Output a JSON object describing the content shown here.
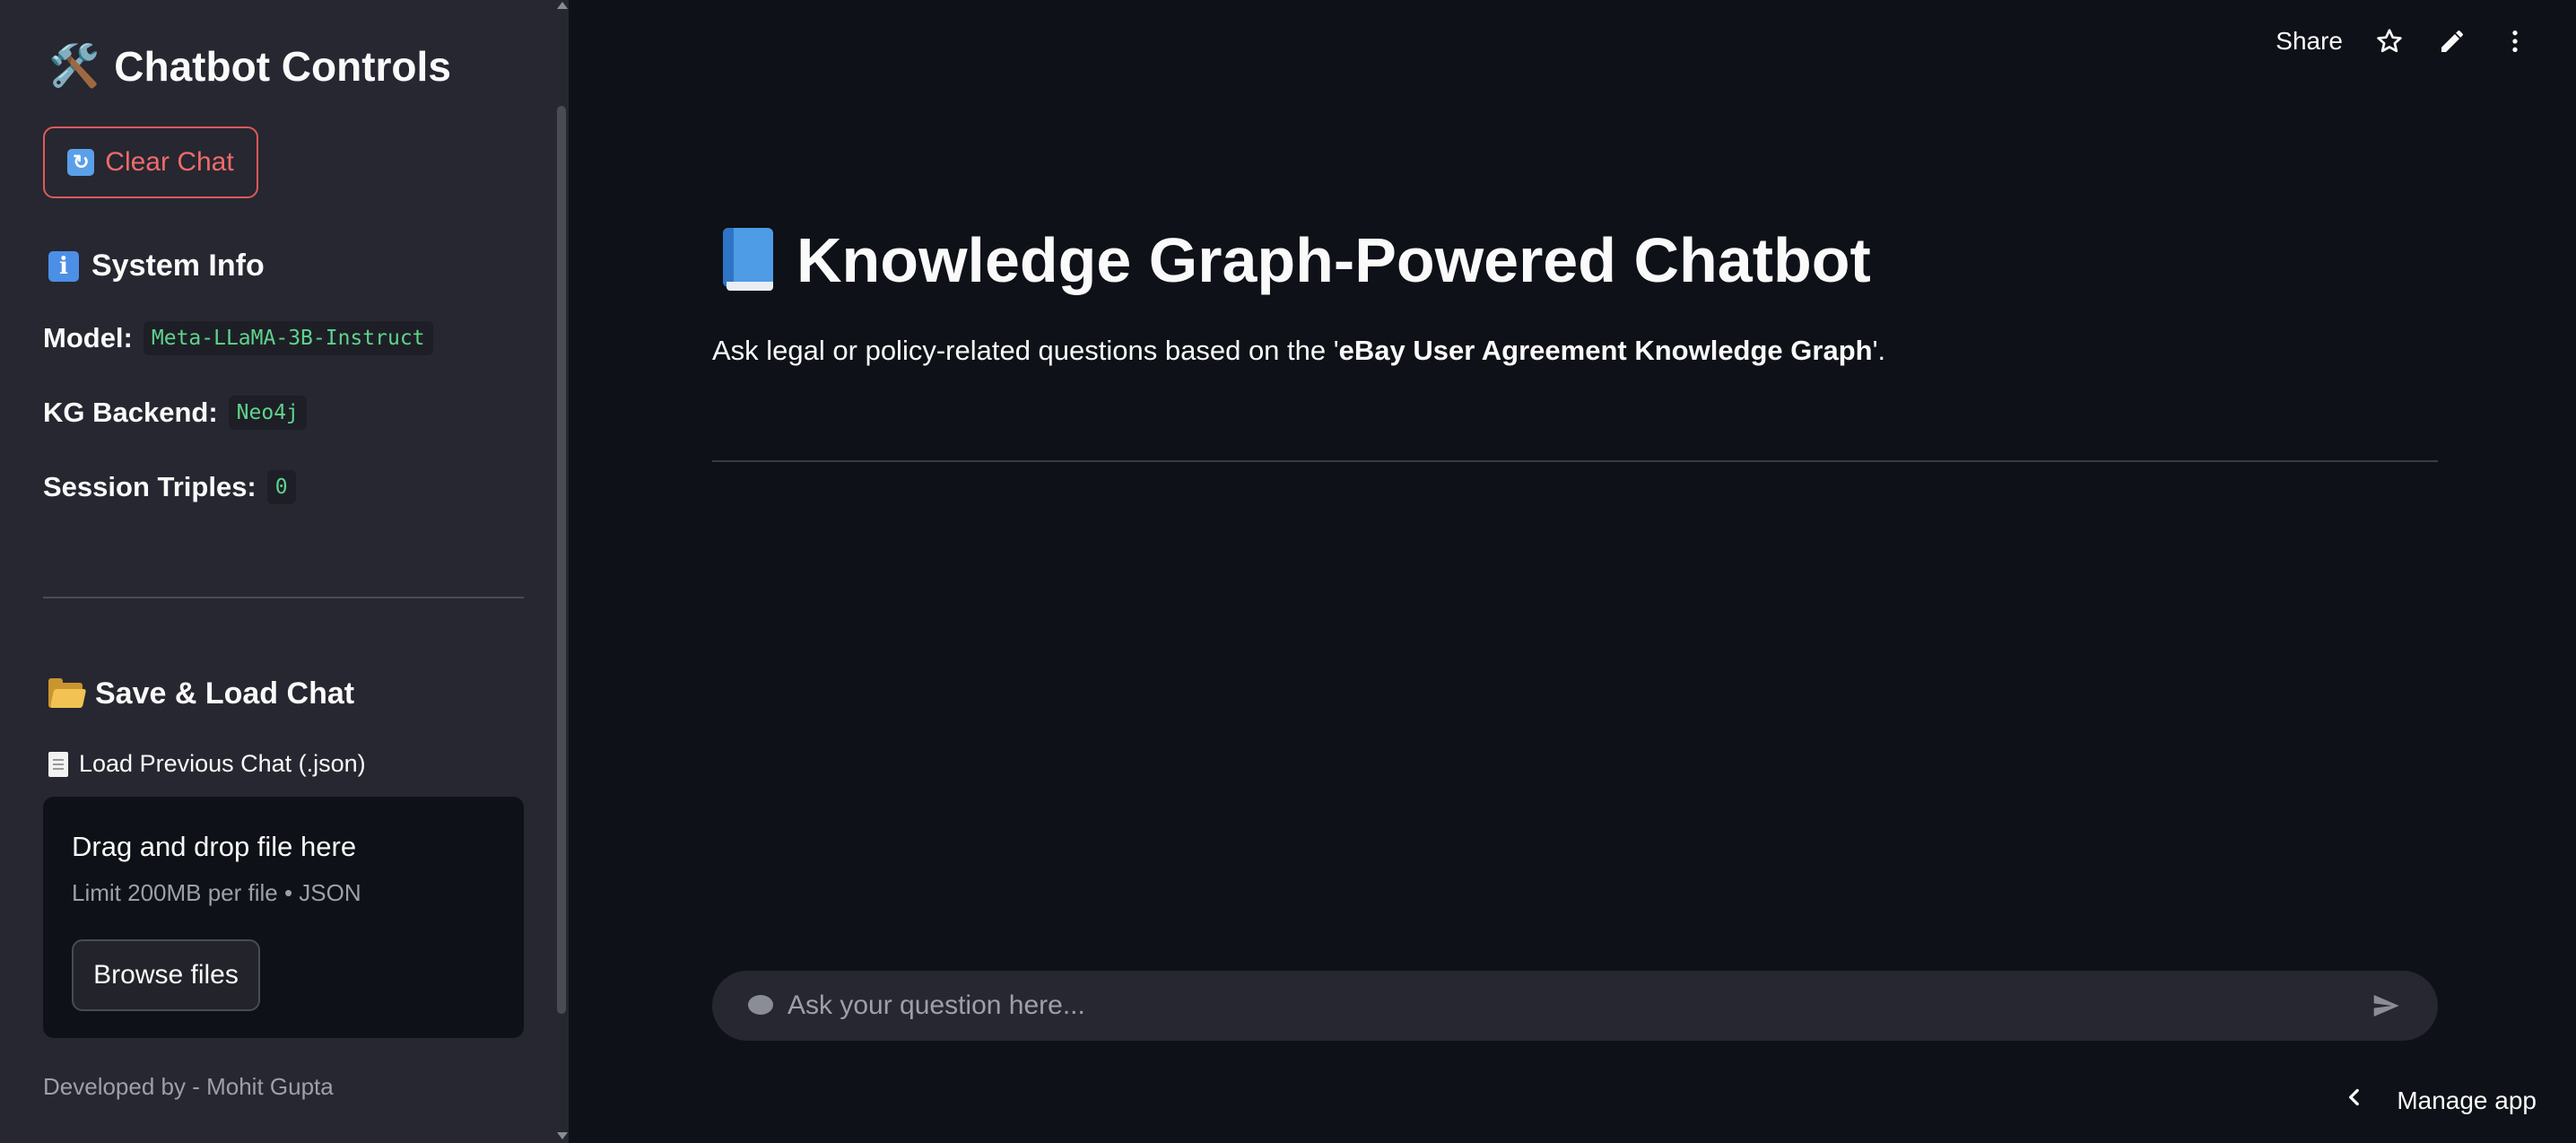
{
  "sidebar": {
    "title": "Chatbot Controls",
    "title_emoji": "🛠️",
    "clear_chat_label": "Clear Chat",
    "clear_chat_icon_glyph": "🔄",
    "system_info": {
      "heading": "System Info",
      "model_label": "Model:",
      "model_value": "Meta-LLaMA-3B-Instruct",
      "kg_backend_label": "KG Backend:",
      "kg_backend_value": "Neo4j",
      "session_triples_label": "Session Triples:",
      "session_triples_value": "0"
    },
    "save_load": {
      "heading": "Save & Load Chat",
      "file_label": "Load Previous Chat (.json)",
      "dropzone_title": "Drag and drop file here",
      "dropzone_subtitle": "Limit 200MB per file • JSON",
      "browse_label": "Browse files"
    },
    "credit": "Developed by - Mohit Gupta"
  },
  "toolbar": {
    "share_label": "Share",
    "icons": [
      "star-icon",
      "pencil-icon",
      "kebab-menu-icon"
    ]
  },
  "main": {
    "title": "Knowledge Graph-Powered Chatbot",
    "subtitle_prefix": "Ask legal or policy-related questions based on the '",
    "subtitle_bold": "eBay User Agreement Knowledge Graph",
    "subtitle_suffix": "'."
  },
  "chat": {
    "placeholder": "Ask your question here...",
    "value": ""
  },
  "manage_app_label": "Manage app",
  "colors": {
    "background": "#0e1117",
    "sidebar": "#262730",
    "accent_red": "#ef6b6b",
    "code_green": "#5fd38d"
  }
}
